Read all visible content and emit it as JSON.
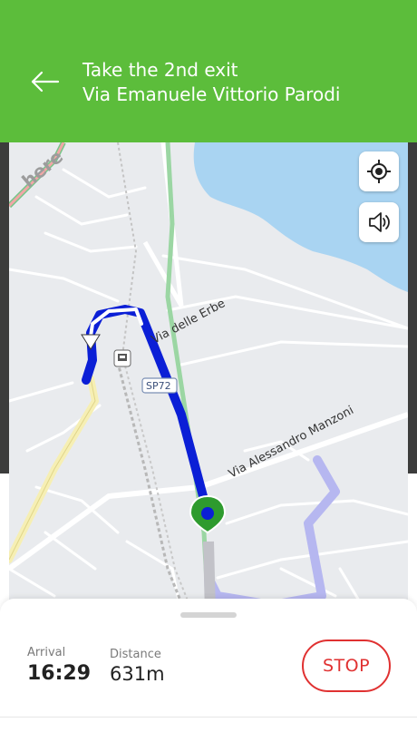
{
  "header": {
    "instruction_line1": "Take the 2nd exit",
    "instruction_line2": "Via Emanuele Vittorio Parodi",
    "background_color": "#5cbd3b"
  },
  "map": {
    "provider_logo": "here",
    "road_labels": {
      "via_delle_erbe": "Via delle Erbe",
      "via_alessandro_manzoni": "Via Alessandro Manzoni",
      "route_shield": "SP72"
    },
    "route_color": "#0b1fd6",
    "current_position_color": "#2e9b2e",
    "water_color": "#a9d4f2",
    "icons": [
      "back-arrow-icon",
      "recenter-location-icon",
      "speaker-icon",
      "train-station-icon",
      "position-marker-icon"
    ]
  },
  "panel": {
    "arrival_label": "Arrival",
    "arrival_value": "16:29",
    "distance_label": "Distance",
    "distance_value": "631m",
    "stop_label": "STOP",
    "stop_color": "#e03131"
  }
}
